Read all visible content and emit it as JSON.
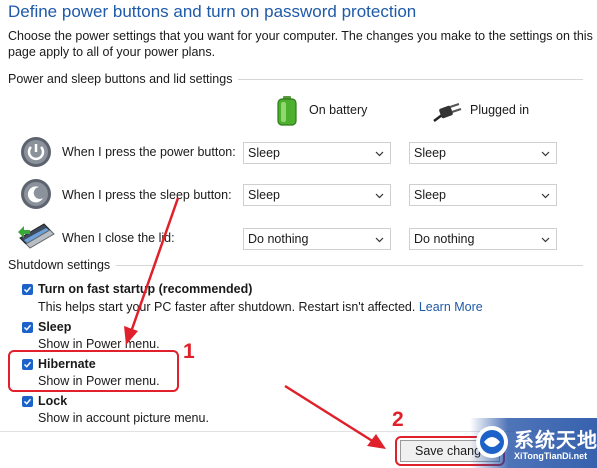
{
  "header": {
    "title": "Define power buttons and turn on password protection",
    "description": "Choose the power settings that you want for your computer. The changes you make to the settings on this page apply to all of your power plans."
  },
  "power_section": {
    "heading": "Power and sleep buttons and lid settings",
    "columns": {
      "battery": "On battery",
      "plugged": "Plugged in"
    },
    "rows": [
      {
        "label": "When I press the power button:",
        "battery": "Sleep",
        "plugged": "Sleep",
        "icon": "power-button-icon"
      },
      {
        "label": "When I press the sleep button:",
        "battery": "Sleep",
        "plugged": "Sleep",
        "icon": "sleep-button-icon"
      },
      {
        "label": "When I close the lid:",
        "battery": "Do nothing",
        "plugged": "Do nothing",
        "icon": "laptop-lid-icon"
      }
    ]
  },
  "shutdown_section": {
    "heading": "Shutdown settings",
    "items": [
      {
        "label": "Turn on fast startup (recommended)",
        "desc": "This helps start your PC faster after shutdown. Restart isn't affected. ",
        "link": "Learn More",
        "checked": true
      },
      {
        "label": "Sleep",
        "desc": "Show in Power menu.",
        "checked": true
      },
      {
        "label": "Hibernate",
        "desc": "Show in Power menu.",
        "checked": true
      },
      {
        "label": "Lock",
        "desc": "Show in account picture menu.",
        "checked": true
      }
    ]
  },
  "footer": {
    "save_label": "Save changes"
  },
  "annotations": {
    "step1": "1",
    "step2": "2",
    "color": "#e0202a"
  },
  "watermark": {
    "title": "系统天地",
    "subtitle": "XiTongTianDi.net"
  },
  "colors": {
    "accent": "#1e5aa8",
    "checkbox": "#1c62c8",
    "annotation": "#e0202a"
  }
}
